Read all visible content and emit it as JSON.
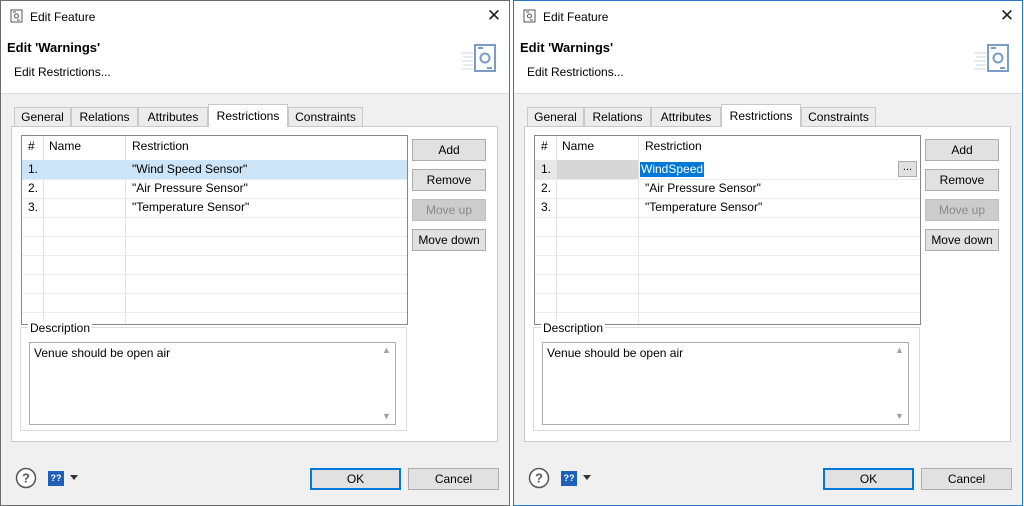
{
  "dialogs": [
    {
      "window_title": "Edit Feature",
      "close_glyph": "✕",
      "banner_title": "Edit 'Warnings'",
      "banner_subtitle": "Edit Restrictions...",
      "tabs": [
        {
          "label": "General"
        },
        {
          "label": "Relations"
        },
        {
          "label": "Attributes"
        },
        {
          "label": "Restrictions"
        },
        {
          "label": "Constraints"
        }
      ],
      "active_tab": "Restrictions",
      "columns": {
        "num": "#",
        "name": "Name",
        "restriction": "Restriction"
      },
      "rows": [
        {
          "num": "1.",
          "name": "",
          "restriction": "\"Wind Speed Sensor\""
        },
        {
          "num": "2.",
          "name": "",
          "restriction": "\"Air Pressure Sensor\""
        },
        {
          "num": "3.",
          "name": "",
          "restriction": "\"Temperature Sensor\""
        }
      ],
      "selected_row": 1,
      "buttons": {
        "add": "Add",
        "remove": "Remove",
        "move_up": "Move up",
        "move_down": "Move down"
      },
      "description_label": "Description",
      "description_text": "Venue should be open air",
      "ok": "OK",
      "cancel": "Cancel",
      "help_glyph": "?",
      "menu_glyph": "??"
    },
    {
      "window_title": "Edit Feature",
      "close_glyph": "✕",
      "banner_title": "Edit 'Warnings'",
      "banner_subtitle": "Edit Restrictions...",
      "tabs": [
        {
          "label": "General"
        },
        {
          "label": "Relations"
        },
        {
          "label": "Attributes"
        },
        {
          "label": "Restrictions"
        },
        {
          "label": "Constraints"
        }
      ],
      "active_tab": "Restrictions",
      "columns": {
        "num": "#",
        "name": "Name",
        "restriction": "Restriction"
      },
      "rows": [
        {
          "num": "1.",
          "name": "",
          "restriction": "WindSpeed"
        },
        {
          "num": "2.",
          "name": "",
          "restriction": "\"Air Pressure Sensor\""
        },
        {
          "num": "3.",
          "name": "",
          "restriction": "\"Temperature Sensor\""
        }
      ],
      "editing_row": 1,
      "ellipsis_label": "...",
      "buttons": {
        "add": "Add",
        "remove": "Remove",
        "move_up": "Move up",
        "move_down": "Move down"
      },
      "description_label": "Description",
      "description_text": "Venue should be open air",
      "ok": "OK",
      "cancel": "Cancel",
      "help_glyph": "?",
      "menu_glyph": "??"
    }
  ],
  "colors": {
    "selection": "#cce4f7",
    "edit_highlight": "#0078d7",
    "active_window_border": "#2b78c9"
  }
}
